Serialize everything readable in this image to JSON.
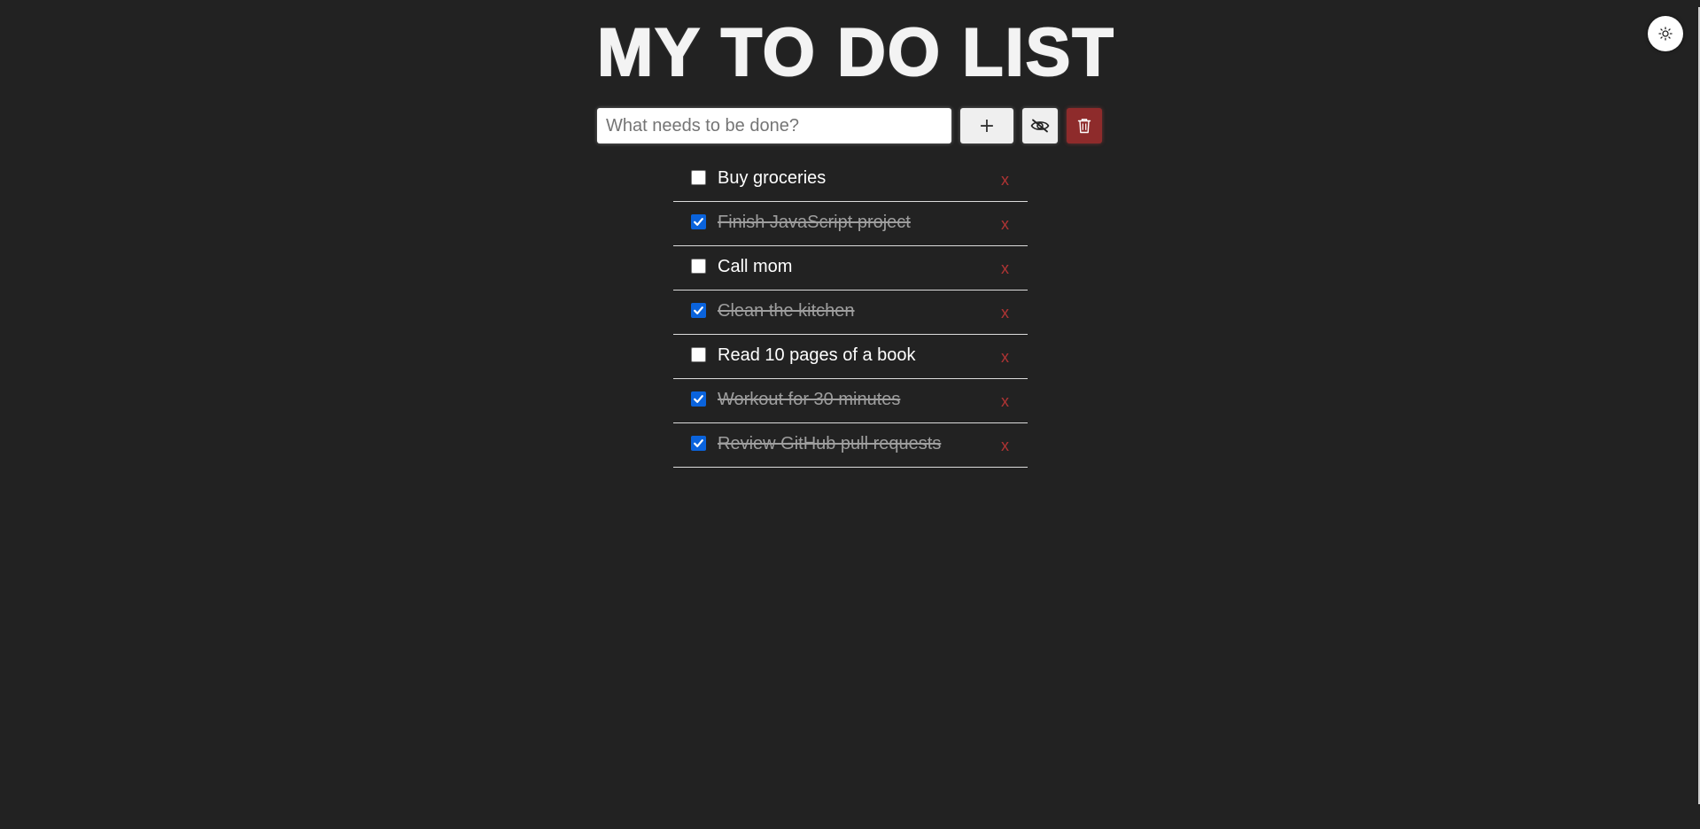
{
  "header": {
    "title": "MY TO DO LIST"
  },
  "toolbar": {
    "input_placeholder": "What needs to be done?",
    "input_value": "",
    "add_label": "+",
    "hide_icon": "eye-slash-icon",
    "clear_icon": "trash-icon"
  },
  "theme_toggle": {
    "icon": "sun-icon"
  },
  "todos": [
    {
      "text": "Buy groceries",
      "done": false,
      "delete_label": "x"
    },
    {
      "text": "Finish JavaScript project",
      "done": true,
      "delete_label": "x"
    },
    {
      "text": "Call mom",
      "done": false,
      "delete_label": "x"
    },
    {
      "text": "Clean the kitchen",
      "done": true,
      "delete_label": "x"
    },
    {
      "text": "Read 10 pages of a book",
      "done": false,
      "delete_label": "x"
    },
    {
      "text": "Workout for 30 minutes",
      "done": true,
      "delete_label": "x"
    },
    {
      "text": "Review GitHub pull requests",
      "done": true,
      "delete_label": "x"
    }
  ],
  "colors": {
    "background": "#222222",
    "checkbox_checked": "#0a63dc",
    "delete": "#b03434",
    "clear_button": "#8e2b2b"
  }
}
